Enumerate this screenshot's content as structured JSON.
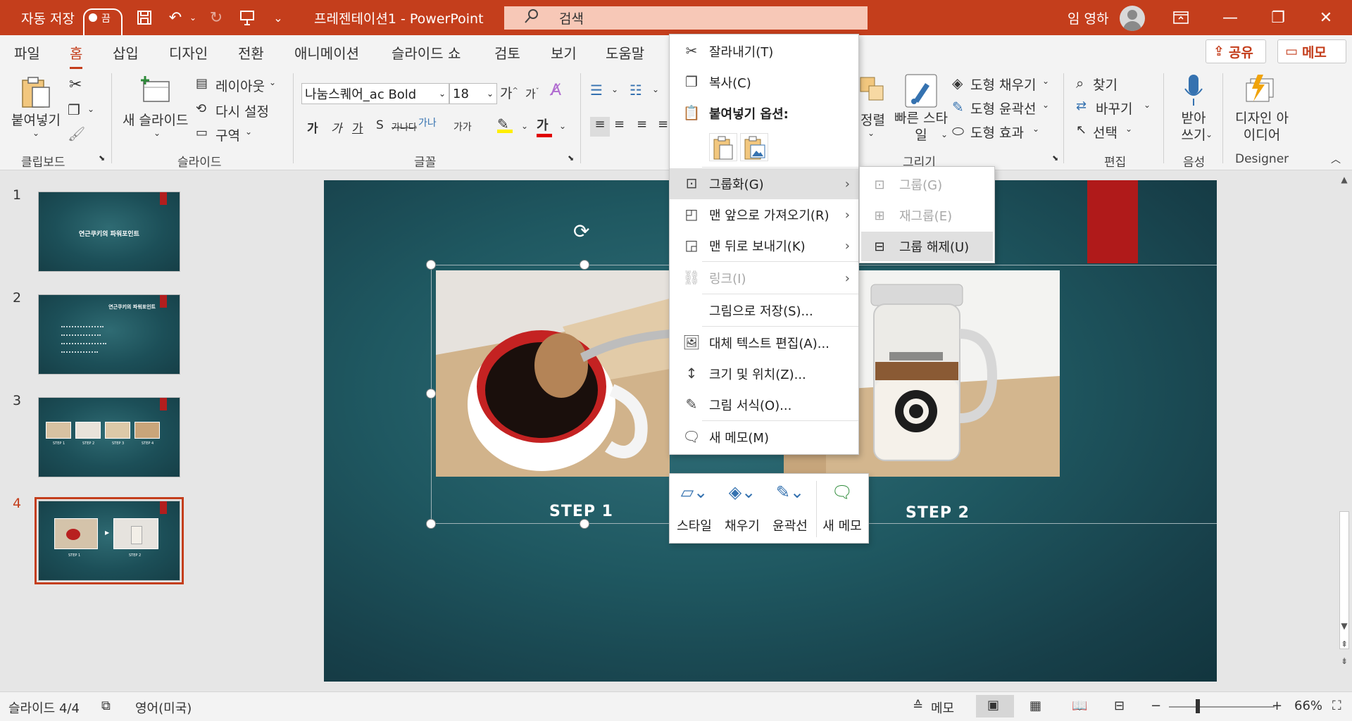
{
  "titlebar": {
    "autosave_label": "자동 저장",
    "autosave_toggle": "끔",
    "doc_title": "프레젠테이션1  -  PowerPoint",
    "search_placeholder": "검색",
    "user_name": "임 영하",
    "accent_color": "#c43e1c"
  },
  "tabs": [
    "파일",
    "홈",
    "삽입",
    "디자인",
    "전환",
    "애니메이션",
    "슬라이드 쇼",
    "검토",
    "보기",
    "도움말"
  ],
  "active_tab": "홈",
  "share_label": "공유",
  "memo_label": "메모",
  "ribbon": {
    "clipboard": {
      "paste": "붙여넣기",
      "group": "클립보드"
    },
    "slides": {
      "new_slide": "새 슬라이드",
      "layout": "레이아웃",
      "reset": "다시 설정",
      "section": "구역",
      "group": "슬라이드"
    },
    "font": {
      "name": "나눔스퀘어_ac Bold",
      "size": "18",
      "group": "글꼴",
      "bold": "가",
      "italic": "가",
      "underline": "가",
      "shadow": "S",
      "strike": "가나다",
      "spacing": "가나",
      "case": "가가",
      "highlight": "가"
    },
    "drawing": {
      "arrange": "정렬",
      "quick_styles": "빠른 스타일",
      "fill": "도형 채우기",
      "outline": "도형 윤곽선",
      "effects": "도형 효과",
      "group": "그리기"
    },
    "editing": {
      "find": "찾기",
      "replace": "바꾸기",
      "select": "선택",
      "group": "편집"
    },
    "voice": {
      "dictate": "받아 쓰기",
      "group": "음성"
    },
    "designer": {
      "ideas": "디자인 아이디어",
      "group": "Designer"
    }
  },
  "thumbnails": [
    {
      "num": "1",
      "title": "연근쿠키의 파워포인트"
    },
    {
      "num": "2",
      "title": "연근쿠키의 파워포인트"
    },
    {
      "num": "3",
      "captions": [
        "STEP 1",
        "STEP 2",
        "STEP 3",
        "STEP 4"
      ]
    },
    {
      "num": "4",
      "captions": [
        "STEP 1",
        "STEP 2"
      ]
    }
  ],
  "slide": {
    "step1": "STEP 1",
    "step2": "STEP 2"
  },
  "context_menu": {
    "cut": "잘라내기(T)",
    "copy": "복사(C)",
    "paste_options": "붙여넣기 옵션:",
    "group": "그룹화(G)",
    "bring_front": "맨 앞으로 가져오기(R)",
    "send_back": "맨 뒤로 보내기(K)",
    "link": "링크(I)",
    "save_as_picture": "그림으로 저장(S)...",
    "alt_text": "대체 텍스트 편집(A)...",
    "size_position": "크기 및 위치(Z)...",
    "format_picture": "그림 서식(O)...",
    "new_comment": "새 메모(M)"
  },
  "submenu": {
    "group": "그룹(G)",
    "regroup": "재그룹(E)",
    "ungroup": "그룹 해제(U)"
  },
  "minibar": {
    "style": "스타일",
    "fill": "채우기",
    "outline": "윤곽선",
    "new_comment": "새 메모"
  },
  "statusbar": {
    "slide_info": "슬라이드 4/4",
    "language": "영어(미국)",
    "notes": "메모",
    "zoom": "66%"
  }
}
